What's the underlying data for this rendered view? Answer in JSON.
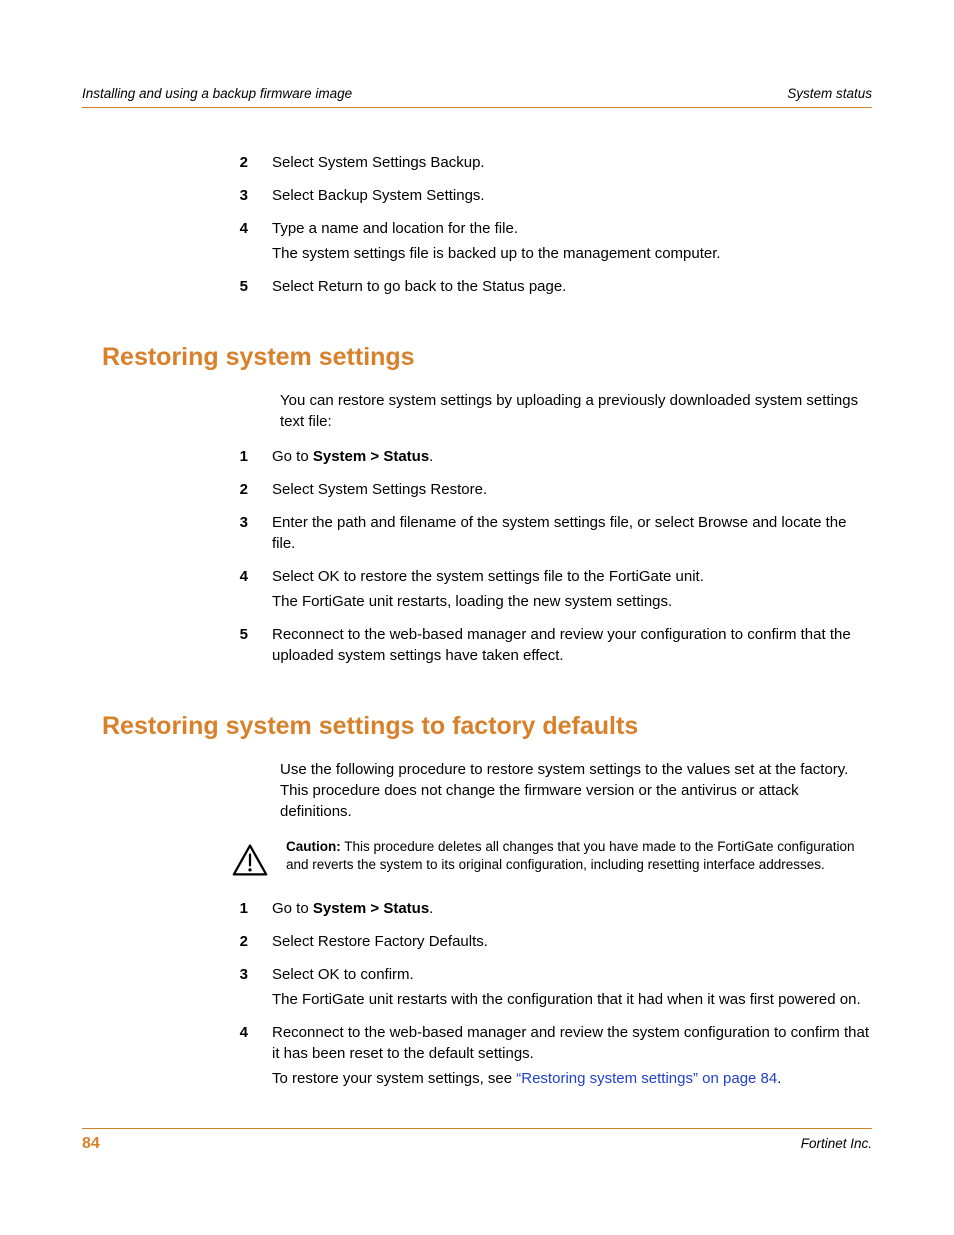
{
  "header": {
    "left": "Installing and using a backup firmware image",
    "right": "System status"
  },
  "top_steps": [
    {
      "n": "2",
      "lines": [
        "Select System Settings Backup."
      ]
    },
    {
      "n": "3",
      "lines": [
        "Select Backup System Settings."
      ]
    },
    {
      "n": "4",
      "lines": [
        "Type a name and location for the file.",
        "The system settings file is backed up to the management computer."
      ]
    },
    {
      "n": "5",
      "lines": [
        "Select Return to go back to the Status page."
      ]
    }
  ],
  "section_restore": {
    "title": "Restoring system settings",
    "intro": "You can restore system settings by uploading a previously downloaded system settings text file:",
    "steps": [
      {
        "n": "1",
        "prefix": "Go to ",
        "bold": "System > Status",
        "suffix": "."
      },
      {
        "n": "2",
        "lines": [
          "Select System Settings Restore."
        ]
      },
      {
        "n": "3",
        "lines": [
          "Enter the path and filename of the system settings file, or select Browse and locate the file."
        ]
      },
      {
        "n": "4",
        "lines": [
          "Select OK to restore the system settings file to the FortiGate unit.",
          "The FortiGate unit restarts, loading the new system settings."
        ]
      },
      {
        "n": "5",
        "lines": [
          "Reconnect to the web-based manager and review your configuration to confirm that the uploaded system settings have taken effect."
        ]
      }
    ]
  },
  "section_factory": {
    "title": "Restoring system settings to factory defaults",
    "intro": "Use the following procedure to restore system settings to the values set at the factory. This procedure does not change the firmware version or the antivirus or attack definitions.",
    "caution_label": "Caution:",
    "caution_text": " This procedure deletes all changes that you have made to the FortiGate configuration and reverts the system to its original configuration, including resetting interface addresses.",
    "steps": [
      {
        "n": "1",
        "prefix": "Go to ",
        "bold": "System > Status",
        "suffix": "."
      },
      {
        "n": "2",
        "lines": [
          "Select Restore Factory Defaults."
        ]
      },
      {
        "n": "3",
        "lines": [
          "Select OK to confirm.",
          "The FortiGate unit restarts with the configuration that it had when it was first powered on."
        ]
      },
      {
        "n": "4",
        "lines_with_link": {
          "line1": "Reconnect to the web-based manager and review the system configuration to confirm that it has been reset to the default settings.",
          "line2_prefix": "To restore your system settings, see ",
          "link_text": "“Restoring system settings” on page 84",
          "line2_suffix": "."
        }
      }
    ]
  },
  "footer": {
    "page": "84",
    "company": "Fortinet Inc."
  }
}
